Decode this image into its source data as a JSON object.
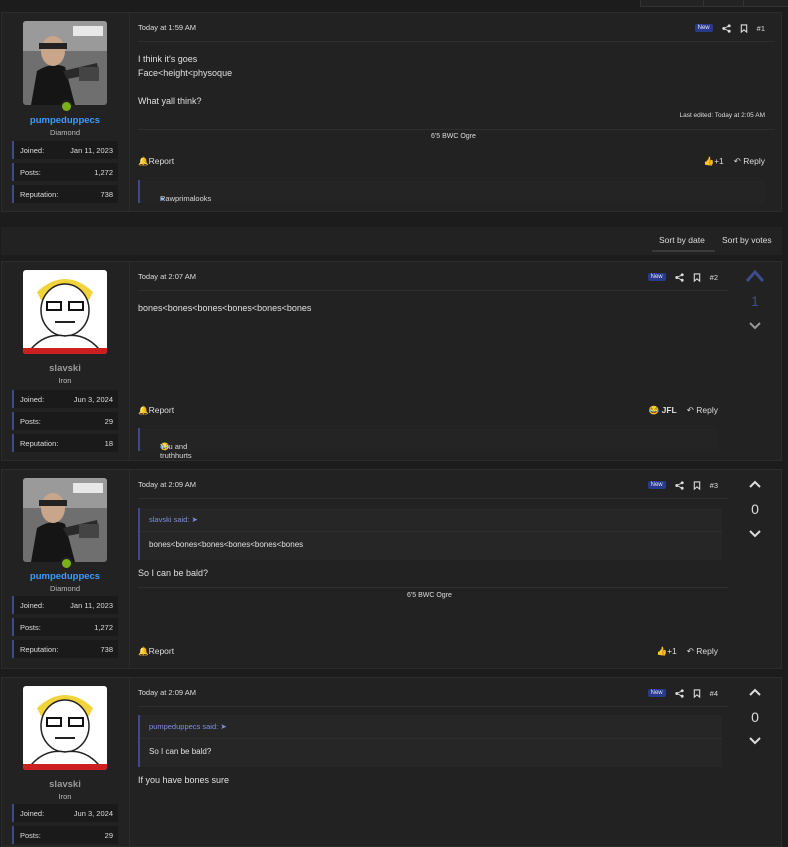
{
  "sort": {
    "by_date": "Sort by date",
    "by_votes": "Sort by votes"
  },
  "posts": [
    {
      "user": {
        "name": "pumpeduppecs",
        "title": "Diamond",
        "joined_label": "Joined:",
        "joined": "Jan 11, 2023",
        "posts_label": "Posts:",
        "posts": "1,272",
        "rep_label": "Reputation:",
        "rep": "738"
      },
      "date": "Today at 1:59 AM",
      "badge": "New",
      "num": "#1",
      "lines": [
        "I think it's goes",
        "Face<height<physoque",
        "",
        "What yall think?"
      ],
      "edited": "Last edited: Today at 2:05 AM",
      "signature": "6'5 BWC Ogre",
      "report": "Report",
      "like": "+1",
      "reply": "Reply",
      "reactions": "Rawprimalooks"
    },
    {
      "user": {
        "name": "slavski",
        "title": "Iron",
        "joined_label": "Joined:",
        "joined": "Jun 3, 2024",
        "posts_label": "Posts:",
        "posts": "29",
        "rep_label": "Reputation:",
        "rep": "18"
      },
      "date": "Today at 2:07 AM",
      "badge": "New",
      "num": "#2",
      "text": "bones<bones<bones<bones<bones<bones",
      "report": "Report",
      "reaction_label": "JFL",
      "reply": "Reply",
      "reactions": "You and truthhurts",
      "score": "1"
    },
    {
      "user": {
        "name": "pumpeduppecs",
        "title": "Diamond",
        "joined_label": "Joined:",
        "joined": "Jan 11, 2023",
        "posts_label": "Posts:",
        "posts": "1,272",
        "rep_label": "Reputation:",
        "rep": "738"
      },
      "date": "Today at 2:09 AM",
      "badge": "New",
      "num": "#3",
      "quote_author": "slavski said:",
      "quote_text": "bones<bones<bones<bones<bones<bones",
      "text": "So I can be bald?",
      "signature": "6'5 BWC Ogre",
      "report": "Report",
      "like": "+1",
      "reply": "Reply",
      "score": "0"
    },
    {
      "user": {
        "name": "slavski",
        "title": "Iron",
        "joined_label": "Joined:",
        "joined": "Jun 3, 2024",
        "posts_label": "Posts:",
        "posts": "29"
      },
      "date": "Today at 2:09 AM",
      "badge": "New",
      "num": "#4",
      "quote_author": "pumpeduppecs said:",
      "quote_text": "So I can be bald?",
      "text": "If you have bones sure",
      "score": "0"
    }
  ]
}
